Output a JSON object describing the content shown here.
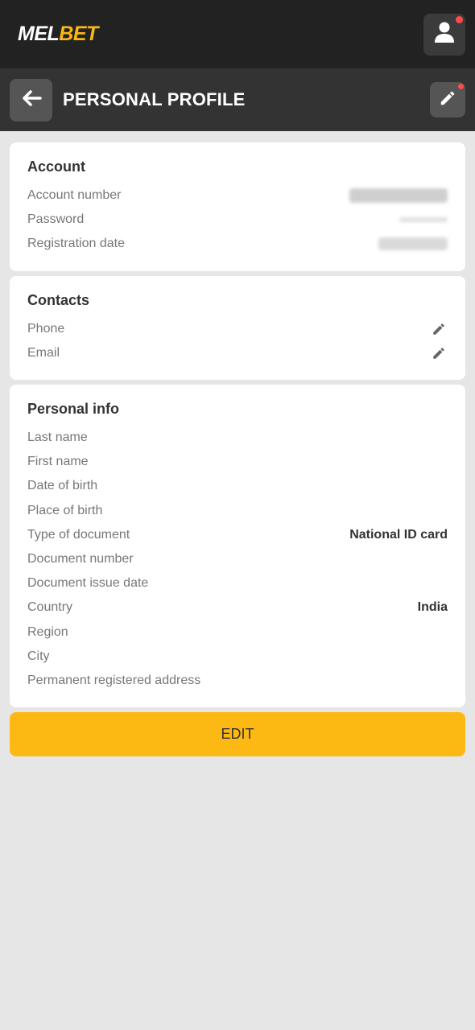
{
  "header": {
    "logo_part1": "MEL",
    "logo_part2": "BET",
    "user_icon": "user-icon"
  },
  "subheader": {
    "title": "PERSONAL PROFILE",
    "back_icon": "arrow-left-icon",
    "edit_icon": "pencil-icon"
  },
  "account": {
    "heading": "Account",
    "rows": [
      {
        "label": "Account number"
      },
      {
        "label": "Password"
      },
      {
        "label": "Registration date"
      }
    ]
  },
  "contacts": {
    "heading": "Contacts",
    "rows": [
      {
        "label": "Phone",
        "icon": "pencil-icon"
      },
      {
        "label": "Email",
        "icon": "pencil-icon"
      }
    ]
  },
  "personal": {
    "heading": "Personal info",
    "rows": [
      {
        "label": "Last name",
        "value": ""
      },
      {
        "label": "First name",
        "value": ""
      },
      {
        "label": "Date of birth",
        "value": ""
      },
      {
        "label": "Place of birth",
        "value": ""
      },
      {
        "label": "Type of document",
        "value": "National ID card"
      },
      {
        "label": "Document number",
        "value": ""
      },
      {
        "label": "Document issue date",
        "value": ""
      },
      {
        "label": "Country",
        "value": "India"
      },
      {
        "label": "Region",
        "value": ""
      },
      {
        "label": "City",
        "value": ""
      },
      {
        "label": "Permanent registered address",
        "value": ""
      }
    ]
  },
  "edit_button": {
    "label": "EDIT"
  },
  "colors": {
    "accent": "#fdb913",
    "header_bg": "#222222",
    "subheader_bg": "#333333",
    "notification": "#ff4d4f"
  }
}
